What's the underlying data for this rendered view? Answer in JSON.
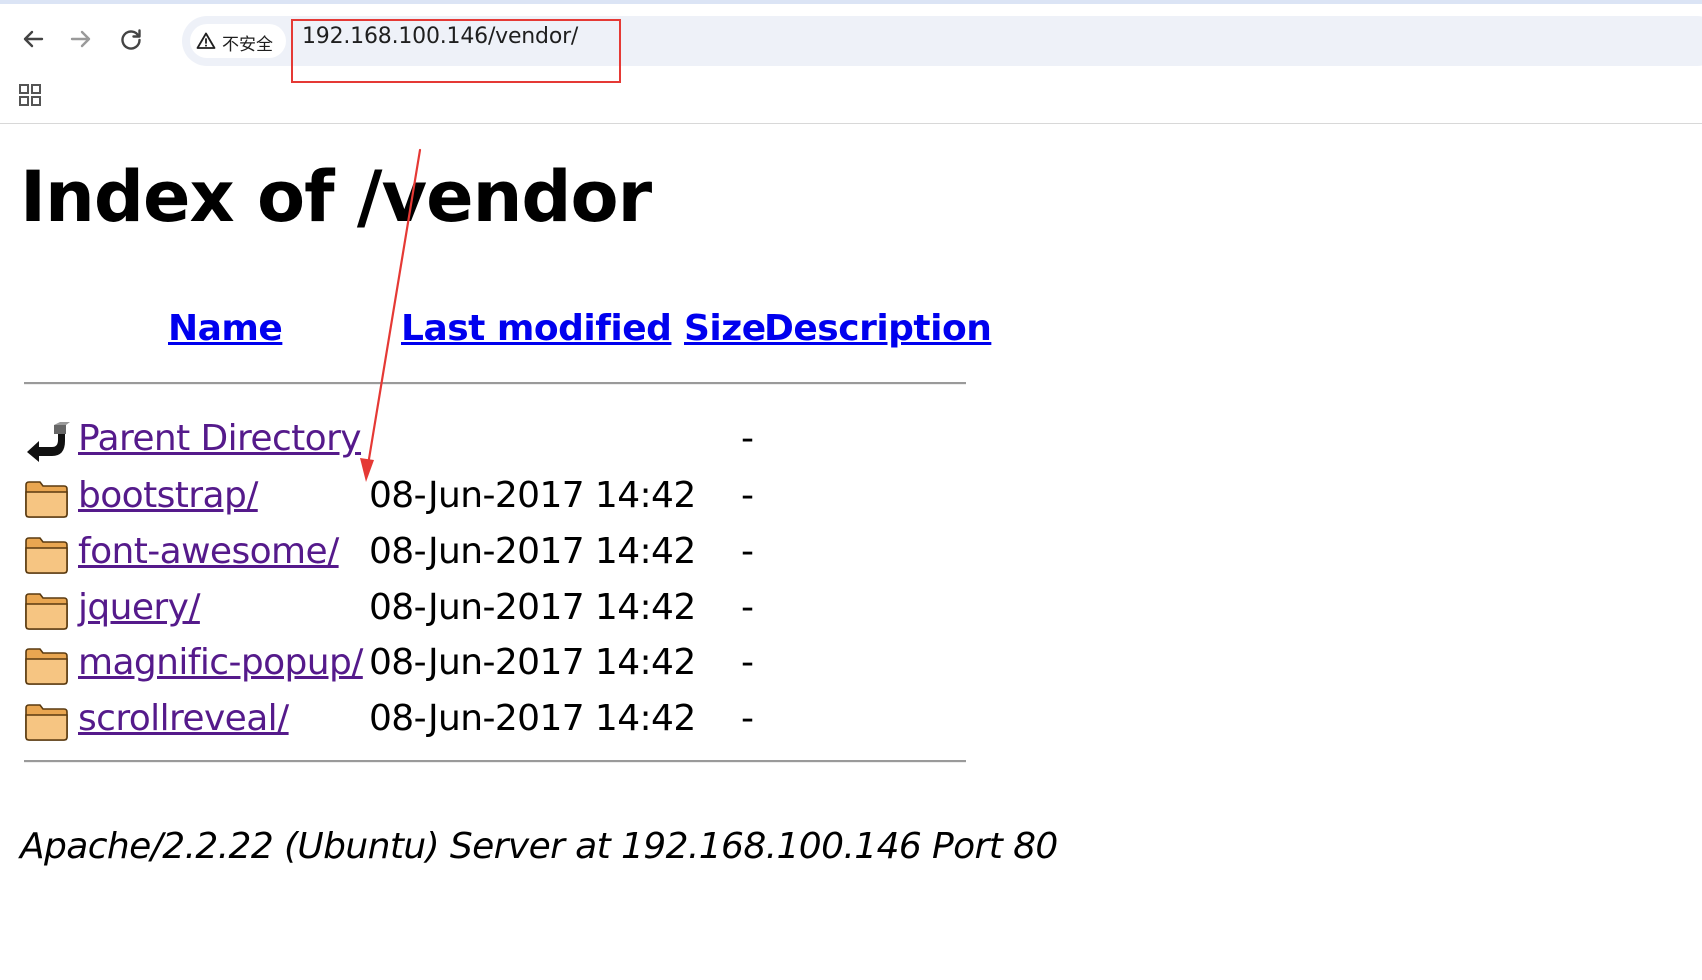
{
  "browser": {
    "security_label": "不安全",
    "url": "192.168.100.146/vendor/",
    "icons": {
      "back": "back-arrow-icon",
      "forward": "forward-arrow-icon",
      "reload": "reload-icon",
      "warning": "warning-triangle-icon",
      "apps": "apps-grid-icon"
    }
  },
  "page": {
    "heading": "Index of /vendor",
    "columns": {
      "name": "Name",
      "last_modified": "Last modified",
      "size": "Size",
      "description": "Description"
    },
    "entries": [
      {
        "name": "Parent Directory",
        "date": "",
        "size": "-",
        "icon": "parent-directory-icon"
      },
      {
        "name": "bootstrap/",
        "date": "08-Jun-2017 14:42",
        "size": "-",
        "icon": "folder-icon"
      },
      {
        "name": "font-awesome/",
        "date": "08-Jun-2017 14:42",
        "size": "-",
        "icon": "folder-icon"
      },
      {
        "name": "jquery/",
        "date": "08-Jun-2017 14:42",
        "size": "-",
        "icon": "folder-icon"
      },
      {
        "name": "magnific-popup/",
        "date": "08-Jun-2017 14:42",
        "size": "-",
        "icon": "folder-icon"
      },
      {
        "name": "scrollreveal/",
        "date": "08-Jun-2017 14:42",
        "size": "-",
        "icon": "folder-icon"
      }
    ],
    "footer": "Apache/2.2.22 (Ubuntu) Server at 192.168.100.146 Port 80"
  },
  "colors": {
    "link": "#0000ee",
    "visited_link": "#551a8b",
    "annotation": "#e53935",
    "folder_fill": "#f4c27a"
  }
}
